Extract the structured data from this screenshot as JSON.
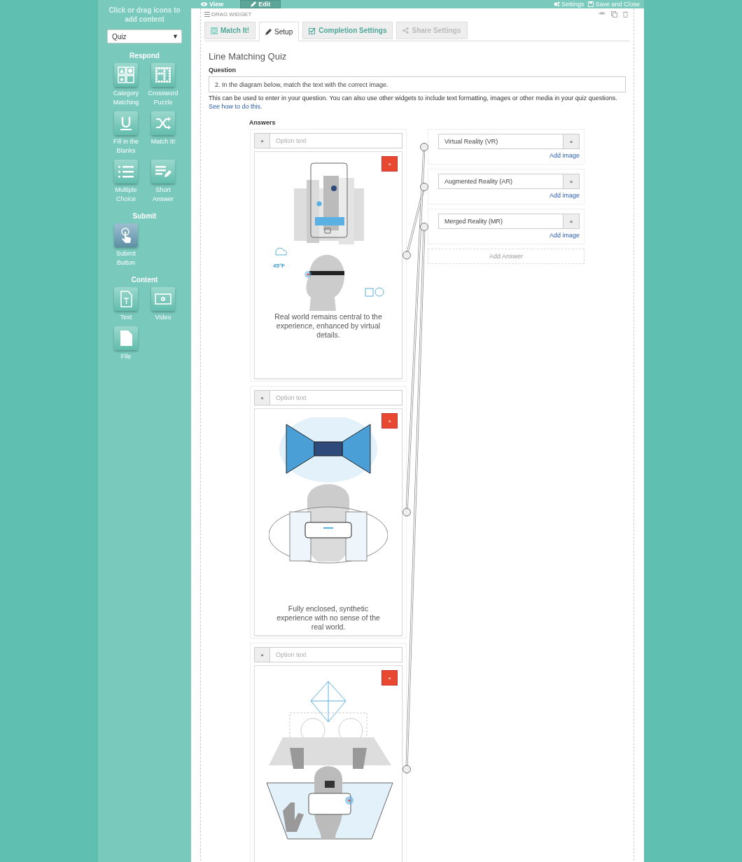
{
  "sidebar": {
    "heading": "Click or drag icons to add content",
    "select": {
      "value": "Quiz",
      "caret": "▼"
    },
    "sections": [
      {
        "title": "Respond",
        "items": [
          {
            "label": "Category Matching",
            "kind": "category"
          },
          {
            "label": "Crossword Puzzle",
            "kind": "crossword"
          },
          {
            "label": "Fill in the Blanks",
            "kind": "blanks"
          },
          {
            "label": "Match It!",
            "kind": "match"
          },
          {
            "label": "Multiple Choice",
            "kind": "choice"
          },
          {
            "label": "Short Answer",
            "kind": "short"
          }
        ]
      },
      {
        "title": "Submit",
        "items": [
          {
            "label": "Submit Button",
            "kind": "submit"
          }
        ]
      },
      {
        "title": "Content",
        "items": [
          {
            "label": "Text",
            "kind": "text"
          },
          {
            "label": "Video",
            "kind": "video"
          },
          {
            "label": "File",
            "kind": "file"
          }
        ]
      }
    ]
  },
  "topbar": {
    "modes": [
      {
        "label": "View",
        "selected": false
      },
      {
        "label": "Edit",
        "selected": true
      }
    ],
    "actions": [
      {
        "label": "Settings",
        "kind": "settings"
      },
      {
        "label": "Save and Close",
        "kind": "save"
      }
    ]
  },
  "widget": {
    "handle": "DRAG WIDGET",
    "tabs": [
      {
        "label": "Match It!",
        "kind": "match",
        "selected": false,
        "disabled": false
      },
      {
        "label": "Setup",
        "kind": "setup",
        "selected": true,
        "disabled": false
      },
      {
        "label": "Completion Settings",
        "kind": "completion",
        "selected": false,
        "disabled": false
      },
      {
        "label": "Share Settings",
        "kind": "share",
        "selected": false,
        "disabled": true
      }
    ],
    "title": "Line Matching Quiz",
    "question_label": "Question",
    "question_value": "2. In the diagram below, match the text with the correct image.",
    "help": "This can be used to enter in your question. You can also use other widgets to include text formatting, images or other media in your quiz questions.",
    "help_link": "See how to do this.",
    "answers_label": "Answers",
    "options": [
      {
        "remove": "×",
        "placeholder": "Option text",
        "kind": "ar",
        "delete": "×",
        "badge": "45°F",
        "caption": "Real world remains central to the experience, enhanced by virtual details."
      },
      {
        "remove": "×",
        "placeholder": "Option text",
        "kind": "vr",
        "delete": "×",
        "caption": "Fully enclosed, synthetic experience with no sense of the real world."
      },
      {
        "remove": "×",
        "placeholder": "Option text",
        "kind": "mr",
        "delete": "×"
      }
    ],
    "targets": [
      {
        "value": "Virtual Reality (VR)",
        "remove": "×",
        "link": "Add image"
      },
      {
        "value": "Augmented Reality (AR)",
        "remove": "×",
        "link": "Add image"
      },
      {
        "value": "Merged Reality (MR)",
        "remove": "×",
        "link": "Add image"
      }
    ],
    "add_answer": "Add Answer"
  }
}
